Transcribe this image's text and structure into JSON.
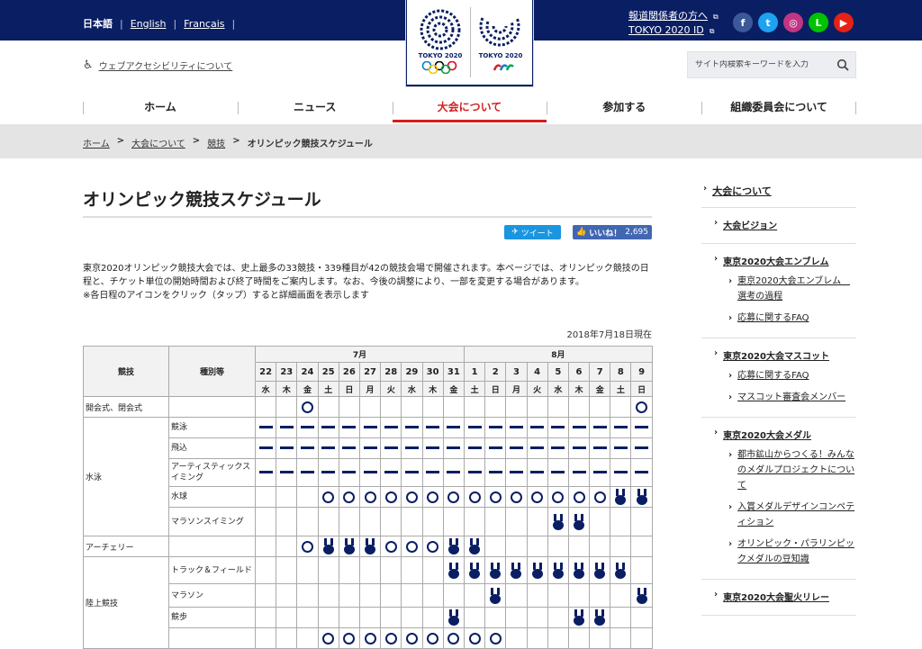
{
  "header": {
    "languages": [
      "日本語",
      "English",
      "Français"
    ],
    "logo_olympic": "TOKYO 2020",
    "logo_paralympic": "TOKYO 2020",
    "press_link": "報道関係者の方へ",
    "id_link": "TOKYO 2020 ID",
    "sns": [
      {
        "name": "facebook",
        "glyph": "f",
        "color": "#3b5998"
      },
      {
        "name": "twitter",
        "glyph": "t",
        "color": "#1da1f2"
      },
      {
        "name": "instagram",
        "glyph": "◎",
        "color": "#c13584"
      },
      {
        "name": "line",
        "glyph": "L",
        "color": "#00c300"
      },
      {
        "name": "youtube",
        "glyph": "▶",
        "color": "#e62117"
      }
    ],
    "accessibility": "ウェブアクセシビリティについて",
    "search_placeholder": "サイト内検索キーワードを入力"
  },
  "nav": [
    "ホーム",
    "ニュース",
    "大会について",
    "参加する",
    "組織委員会について"
  ],
  "breadcrumb": [
    "ホーム",
    "大会について",
    "競技",
    "オリンピック競技スケジュール"
  ],
  "page": {
    "title": "オリンピック競技スケジュール",
    "tweet": "ツイート",
    "like": "いいね！",
    "like_count": "2,695",
    "intro": "東京2020オリンピック競技大会では、史上最多の33競技・339種目が42の競技会場で開催されます。本ページでは、オリンピック競技の日程と、チケット単位の開始時間および終了時間をご案内します。なお、今後の調整により、一部を変更する場合があります。",
    "note": "※各日程のアイコンをクリック（タップ）すると詳細画面を表示します",
    "as_of": "2018年7月18日現在"
  },
  "table": {
    "col_sport": "競技",
    "col_event": "種別等",
    "months": [
      {
        "label": "7月",
        "span": 10
      },
      {
        "label": "8月",
        "span": 9
      }
    ],
    "days": [
      "22",
      "23",
      "24",
      "25",
      "26",
      "27",
      "28",
      "29",
      "30",
      "31",
      "1",
      "2",
      "3",
      "4",
      "5",
      "6",
      "7",
      "8",
      "9"
    ],
    "weekdays": [
      "水",
      "木",
      "金",
      "土",
      "日",
      "月",
      "火",
      "水",
      "木",
      "金",
      "土",
      "日",
      "月",
      "火",
      "水",
      "木",
      "金",
      "土",
      "日"
    ],
    "icon_legend": {
      "O": "ring",
      "-": "dash",
      "M": "medal",
      ".": "none"
    }
  },
  "chart_data": {
    "type": "table",
    "rows": [
      {
        "sport": "開会式、閉会式",
        "event": "",
        "sport_rowspan": 1,
        "marks": "..O...............O"
      },
      {
        "sport": "水泳",
        "event": "競泳",
        "sport_rowspan": 5,
        "marks": "-------------------"
      },
      {
        "sport": "",
        "event": "飛込",
        "marks": "-------------------"
      },
      {
        "sport": "",
        "event": "アーティスティックスイミング",
        "marks": "-------------------"
      },
      {
        "sport": "",
        "event": "水球",
        "marks": "...OOOOOOOOOOOOOOMM"
      },
      {
        "sport": "",
        "event": "マラソンスイミング",
        "marks": "..............MM..."
      },
      {
        "sport": "アーチェリー",
        "event": "",
        "sport_rowspan": 1,
        "marks": "..OMMMOOOMM........"
      },
      {
        "sport": "陸上競技",
        "event": "トラック＆フィールド",
        "sport_rowspan": 4,
        "marks": ".........MMMMMMMMM."
      },
      {
        "sport": "",
        "event": "マラソン",
        "marks": "...........M......M"
      },
      {
        "sport": "",
        "event": "競歩",
        "marks": ".........M.....MM.."
      },
      {
        "sport": "",
        "event": "",
        "marks": "...OOOOOOOOO......."
      }
    ]
  },
  "sidebar": {
    "heading": "大会について",
    "items": [
      {
        "label": "大会ビジョン",
        "children": []
      },
      {
        "label": "東京2020大会エンブレム",
        "children": [
          "東京2020大会エンブレム　選考の過程",
          "応募に関するFAQ"
        ]
      },
      {
        "label": "東京2020大会マスコット",
        "children": [
          "応募に関するFAQ",
          "マスコット審査会メンバー"
        ]
      },
      {
        "label": "東京2020大会メダル",
        "children": [
          "都市鉱山からつくる！みんなのメダルプロジェクトについて",
          "入賞メダルデザインコンペティション",
          "オリンピック・パラリンピックメダルの豆知識"
        ]
      },
      {
        "label": "東京2020大会聖火リレー",
        "children": []
      }
    ]
  }
}
